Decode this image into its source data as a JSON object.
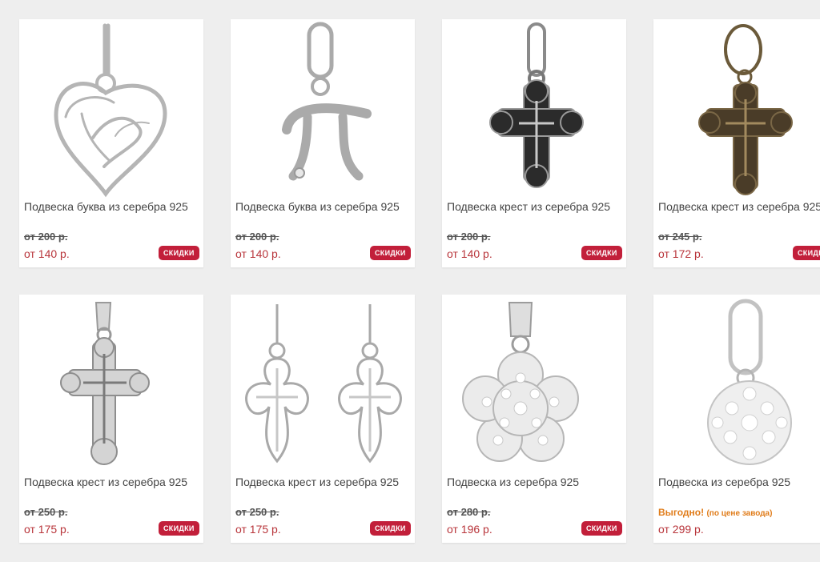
{
  "products": [
    {
      "title": "Подвеска буква из серебра 925",
      "old_price": "от 200 р.",
      "price": "от 140 р.",
      "badge": "скидки",
      "image": "heart-letter-pendant"
    },
    {
      "title": "Подвеска буква из серебра 925",
      "old_price": "от 200 р.",
      "price": "от 140 р.",
      "badge": "скидки",
      "image": "letter-p-pendant"
    },
    {
      "title": "Подвеска крест из серебра 925",
      "old_price": "от 200 р.",
      "price": "от 140 р.",
      "badge": "скидки",
      "image": "black-cross-pendant"
    },
    {
      "title": "Подвеска крест из серебра 925",
      "old_price": "от 245 р.",
      "price": "от 172 р.",
      "badge": "скидки",
      "image": "bronze-cross-pendant"
    },
    {
      "title": "Подвеска крест из серебра 925",
      "old_price": "от 250 р.",
      "price": "от 175 р.",
      "badge": "скидки",
      "image": "silver-cross-pendant"
    },
    {
      "title": "Подвеска крест из серебра 925",
      "old_price": "от 250 р.",
      "price": "от 175 р.",
      "badge": "скидки",
      "image": "filigree-cross-pair"
    },
    {
      "title": "Подвеска из серебра 925",
      "old_price": "от 280 р.",
      "price": "от 196 р.",
      "badge": "скидки",
      "image": "crystal-flower-pendant"
    },
    {
      "title": "Подвеска из серебра 925",
      "promo_main": "Выгодно!",
      "promo_note": "(по цене завода)",
      "price": "от 299 р.",
      "image": "crystal-ball-pendant"
    }
  ]
}
